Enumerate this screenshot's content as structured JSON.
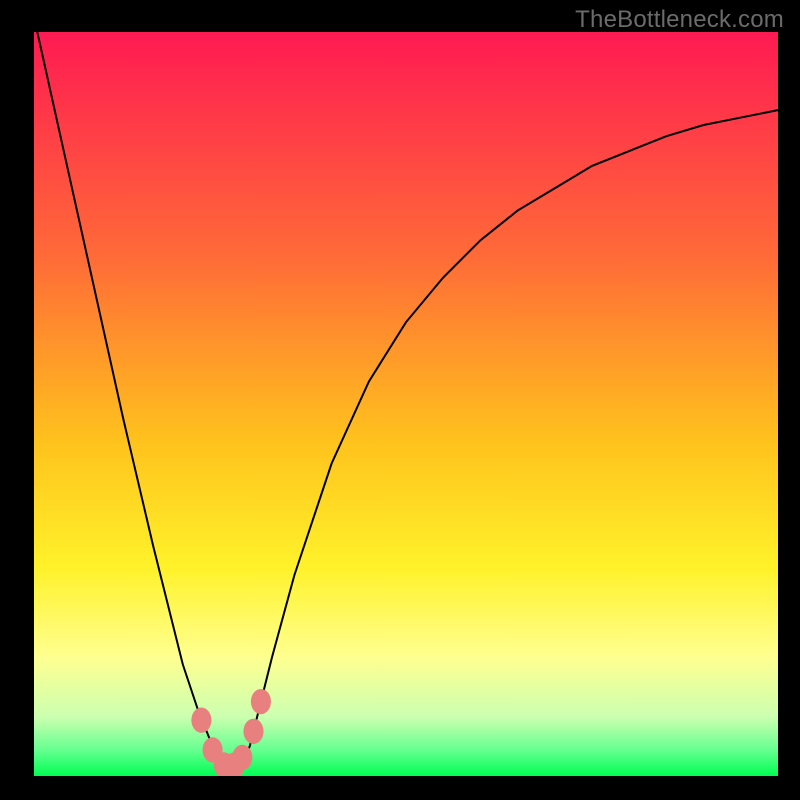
{
  "watermark": "TheBottleneck.com",
  "colors": {
    "frame": "#000000",
    "curve_stroke": "#000000",
    "marker_fill": "#e98080",
    "green_band": "#00fe53",
    "gradient_top": "#ff1a52",
    "gradient_mid1": "#ff7a35",
    "gradient_mid2": "#ffd31a",
    "gradient_mid3": "#ffff66",
    "gradient_mid4": "#e6ff80",
    "gradient_bottom": "#00fe53"
  },
  "chart_data": {
    "type": "line",
    "title": "",
    "xlabel": "",
    "ylabel": "",
    "xlim": [
      0,
      100
    ],
    "ylim": [
      0,
      100
    ],
    "x": [
      0,
      4,
      8,
      12,
      16,
      20,
      22,
      24,
      25,
      26,
      27,
      28,
      29,
      30,
      32,
      35,
      40,
      45,
      50,
      55,
      60,
      65,
      70,
      75,
      80,
      85,
      90,
      95,
      100
    ],
    "values": [
      102,
      84,
      66,
      48,
      31,
      15,
      9,
      4,
      2,
      1,
      1,
      2,
      4,
      8,
      16,
      27,
      42,
      53,
      61,
      67,
      72,
      76,
      79,
      82,
      84,
      86,
      87.5,
      88.5,
      89.5
    ],
    "markers": {
      "x": [
        22.5,
        24,
        25.5,
        27,
        28,
        29.5,
        30.5
      ],
      "y": [
        7.5,
        3.5,
        1.5,
        1.5,
        2.5,
        6,
        10
      ]
    },
    "background_gradient": {
      "direction": "vertical",
      "stops": [
        {
          "pos": 0.0,
          "color": "#ff1a52"
        },
        {
          "pos": 0.3,
          "color": "#ff6a38"
        },
        {
          "pos": 0.55,
          "color": "#ffc21d"
        },
        {
          "pos": 0.72,
          "color": "#fff22a"
        },
        {
          "pos": 0.84,
          "color": "#ffff90"
        },
        {
          "pos": 0.92,
          "color": "#ccffb0"
        },
        {
          "pos": 0.965,
          "color": "#66ff90"
        },
        {
          "pos": 1.0,
          "color": "#00fe53"
        }
      ]
    }
  }
}
